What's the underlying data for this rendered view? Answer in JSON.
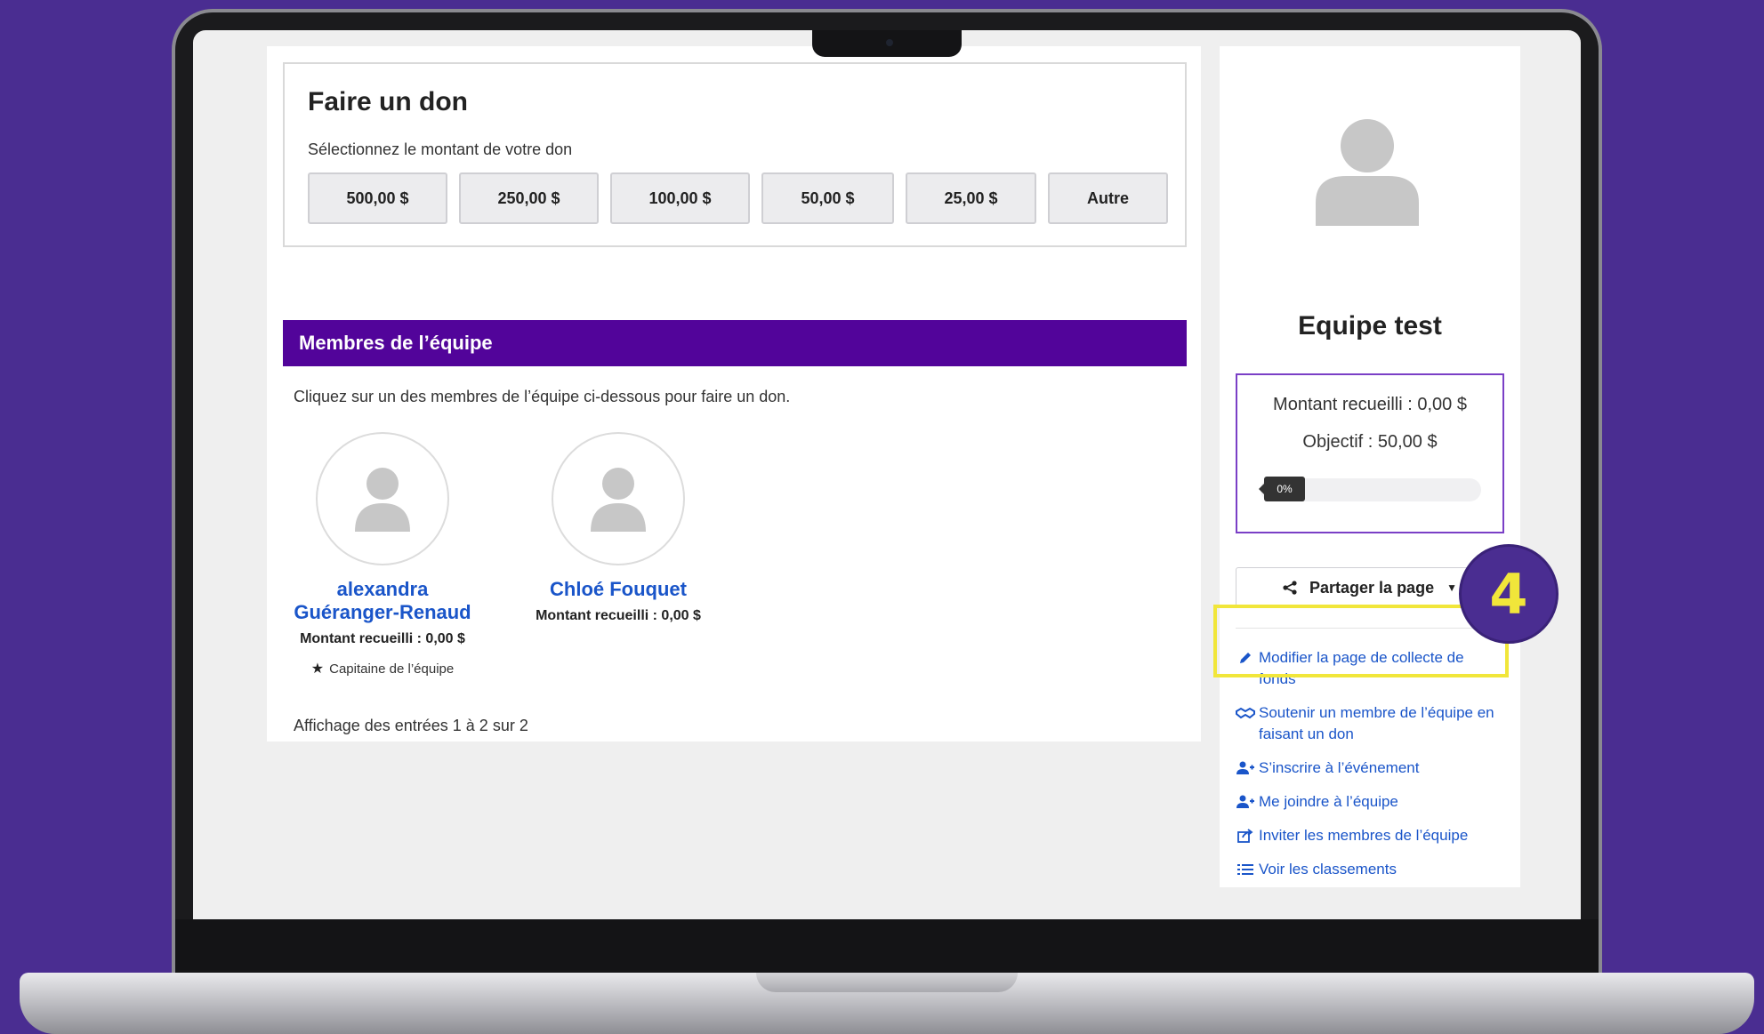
{
  "donation": {
    "title": "Faire un don",
    "subtitle": "Sélectionnez le montant de votre don",
    "amounts": [
      "500,00 $",
      "250,00 $",
      "100,00 $",
      "50,00 $",
      "25,00 $",
      "Autre"
    ]
  },
  "team_section": {
    "header": "Membres de l’équipe",
    "instruction": "Cliquez sur un des membres de l’équipe ci-dessous pour faire un don.",
    "members": [
      {
        "name": "alexandra Guéranger-Renaud",
        "amount": "Montant recueilli : 0,00 $",
        "role": "Capitaine de l’équipe"
      },
      {
        "name": "Chloé Fouquet",
        "amount": "Montant recueilli : 0,00 $"
      }
    ],
    "entries": "Affichage des entrées 1 à 2 sur 2"
  },
  "sidebar": {
    "team_name": "Equipe test",
    "raised": "Montant recueilli : 0,00 $",
    "goal": "Objectif : 50,00 $",
    "progress_label": "0%",
    "progress_value": 0,
    "share_label": "Partager la page",
    "links": [
      {
        "icon": "pencil-icon",
        "label": "Modifier la page de collecte de fonds"
      },
      {
        "icon": "handshake-icon",
        "label": "Soutenir un membre de l’équipe en faisant un don"
      },
      {
        "icon": "user-plus-icon",
        "label": "S’inscrire à l’événement"
      },
      {
        "icon": "user-plus-icon",
        "label": "Me joindre à l’équipe"
      },
      {
        "icon": "share-square-icon",
        "label": "Inviter les membres de l’équipe"
      },
      {
        "icon": "list-icon",
        "label": "Voir les classements"
      }
    ]
  },
  "annotation": {
    "step_number": "4",
    "highlight_color": "#f1e63a"
  },
  "colors": {
    "primary": "#52049a",
    "link": "#1a55c9",
    "background": "#4a2d91"
  }
}
